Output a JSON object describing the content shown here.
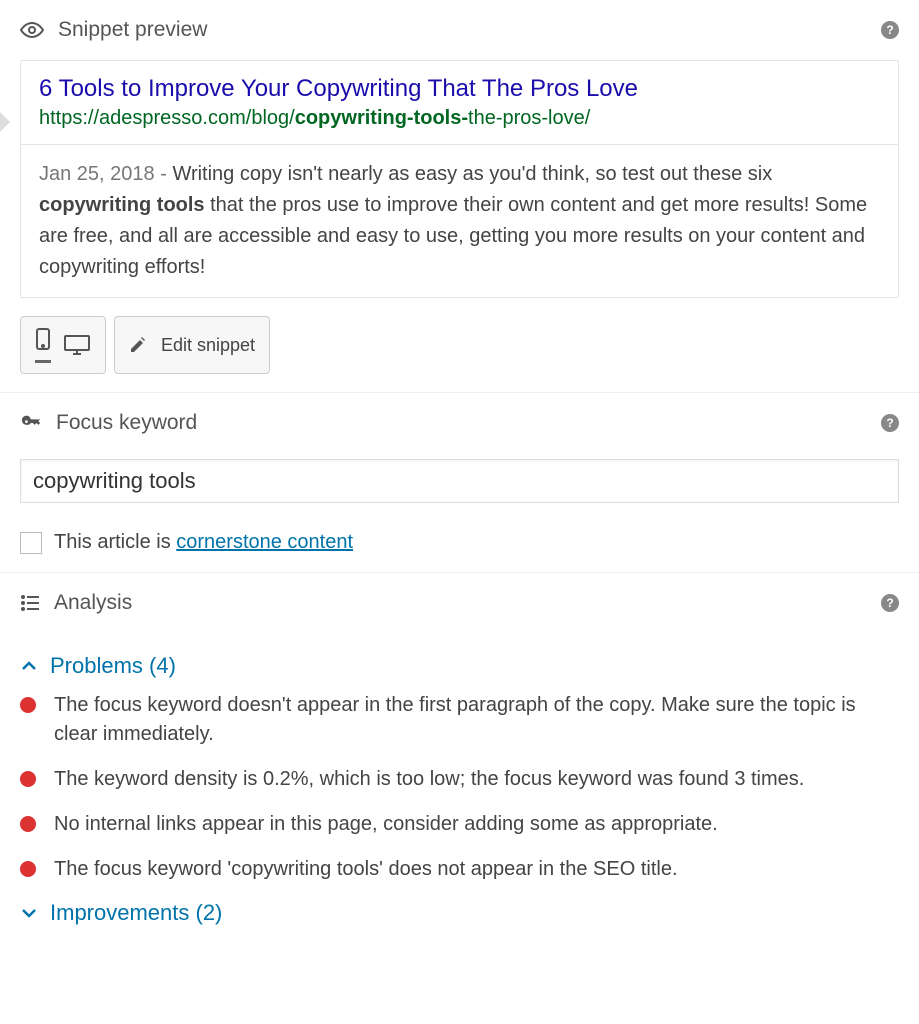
{
  "snippet": {
    "section_title": "Snippet preview",
    "title": "6 Tools to Improve Your Copywriting That The Pros Love",
    "url_pre": "https://adespresso.com/blog/",
    "url_bold": "copywriting-tools-",
    "url_post": "the-pros-love/",
    "date": "Jan 25, 2018 - ",
    "desc_pre": "Writing copy isn't nearly as easy as you'd think, so test out these six ",
    "desc_bold": "copywriting tools",
    "desc_post": " that the pros use to improve their own content and get more results! Some are free, and all are accessible and easy to use, getting you more results on your content and copywriting efforts!",
    "edit_label": "Edit snippet"
  },
  "focus_keyword": {
    "section_title": "Focus keyword",
    "value": "copywriting tools",
    "cornerstone_pre": "This article is ",
    "cornerstone_link": "cornerstone content"
  },
  "analysis": {
    "section_title": "Analysis",
    "problems_label": "Problems (4)",
    "improvements_label": "Improvements (2)",
    "problems": [
      "The focus keyword doesn't appear in the first paragraph of the copy. Make sure the topic is clear immediately.",
      "The keyword density is 0.2%, which is too low; the focus keyword was found 3 times.",
      "No internal links appear in this page, consider adding some as appropriate.",
      "The focus keyword 'copywriting tools' does not appear in the SEO title."
    ]
  }
}
